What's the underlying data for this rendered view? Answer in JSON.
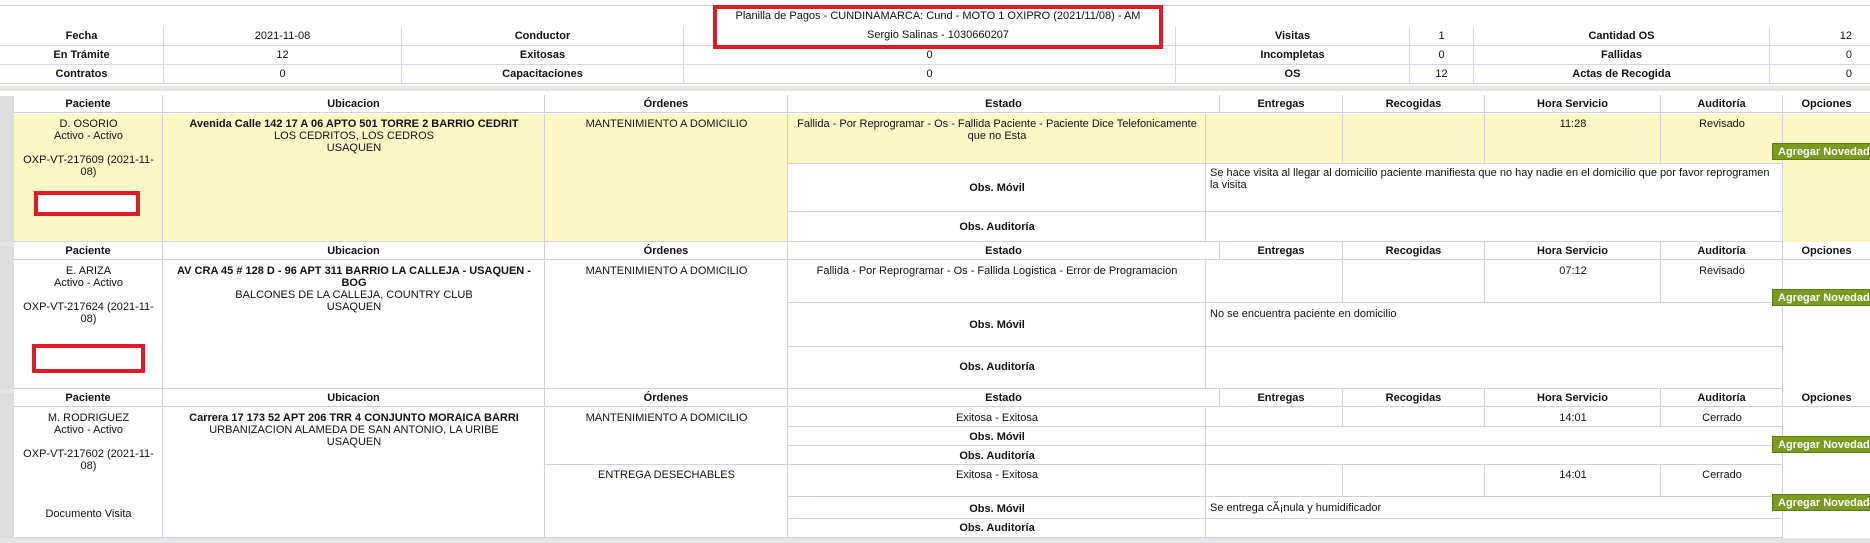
{
  "title": "Planilla de Pagos - CUNDINAMARCA: Cund - MOTO 1 OXIPRO (2021/11/08) - AM",
  "conductor_name": "Sergio Salinas - 1030660207",
  "summary": {
    "fecha_label": "Fecha",
    "fecha": "2021-11-08",
    "conductor_label": "Conductor",
    "visitas_label": "Visitas",
    "visitas": "1",
    "cantidad_os_label": "Cantidad OS",
    "cantidad_os": "12",
    "en_tramite_label": "En Trámite",
    "en_tramite": "12",
    "exitosas_label": "Exitosas",
    "exitosas": "0",
    "incompletas_label": "Incompletas",
    "incompletas": "0",
    "fallidas_label": "Fallidas",
    "fallidas": "0",
    "contratos_label": "Contratos",
    "contratos": "0",
    "capacitaciones_label": "Capacitaciones",
    "capacitaciones": "0",
    "os_label": "OS",
    "os": "12",
    "actas_label": "Actas de Recogida",
    "actas": "0"
  },
  "headers": {
    "paciente": "Paciente",
    "ubicacion": "Ubicacion",
    "ordenes": "Órdenes",
    "estado": "Estado",
    "entregas": "Entregas",
    "recogidas": "Recogidas",
    "hora": "Hora Servicio",
    "auditoria": "Auditoría",
    "opciones": "Opciones"
  },
  "obs_movil_label": "Obs. Móvil",
  "obs_auditoria_label": "Obs. Auditoría",
  "add_button": "Agregar Novedad",
  "rows": [
    {
      "paciente": "D. OSORIO",
      "activo": "Activo - Activo",
      "codigo": "OXP-VT-217609 (2021-11-08)",
      "direccion": "Avenida Calle 142 17 A 06 APTO 501 TORRE 2 BARRIO CEDRIT",
      "barrio": "LOS CEDRITOS, LOS CEDROS",
      "localidad": "USAQUEN",
      "orden": "MANTENIMIENTO A DOMICILIO",
      "estado": "Fallida - Por Reprogramar - Os - Fallida Paciente - Paciente Dice Telefonicamente que no Esta",
      "hora": "11:28",
      "auditoria": "Revisado",
      "obs_movil": "Se hace visita al llegar al domicilio paciente manifiesta que no hay nadie en el domicilio que por favor reprogramen la visita"
    },
    {
      "paciente": "E. ARIZA",
      "activo": "Activo - Activo",
      "codigo": "OXP-VT-217624 (2021-11-08)",
      "direccion": "AV CRA 45 # 128 D - 96 APT 311 BARRIO LA CALLEJA - USAQUEN - BOG",
      "barrio": "BALCONES DE LA CALLEJA, COUNTRY CLUB",
      "localidad": "USAQUEN",
      "orden": "MANTENIMIENTO A DOMICILIO",
      "estado": "Fallida - Por Reprogramar - Os - Fallida Logistica - Error de Programacion",
      "hora": "07:12",
      "auditoria": "Revisado",
      "obs_movil": "No se encuentra paciente en domicilio"
    },
    {
      "paciente": "M. RODRIGUEZ",
      "activo": "Activo - Activo",
      "codigo": "OXP-VT-217602 (2021-11-08)",
      "documento": "Documento Visita",
      "direccion": "Carrera 17 173 52 APT 206 TRR 4 CONJUNTO MORAICA BARRI",
      "barrio": "URBANIZACION ALAMEDA DE SAN ANTONIO, LA URIBE",
      "localidad": "USAQUEN",
      "orden1": "MANTENIMIENTO A DOMICILIO",
      "estado1": "Exitosa - Exitosa",
      "hora1": "14:01",
      "auditoria1": "Cerrado",
      "orden2": "ENTREGA DESECHABLES",
      "estado2": "Exitosa - Exitosa",
      "hora2": "14:01",
      "auditoria2": "Cerrado",
      "obs_movil2": "Se entrega cÃ¡nula y humidificador"
    }
  ]
}
